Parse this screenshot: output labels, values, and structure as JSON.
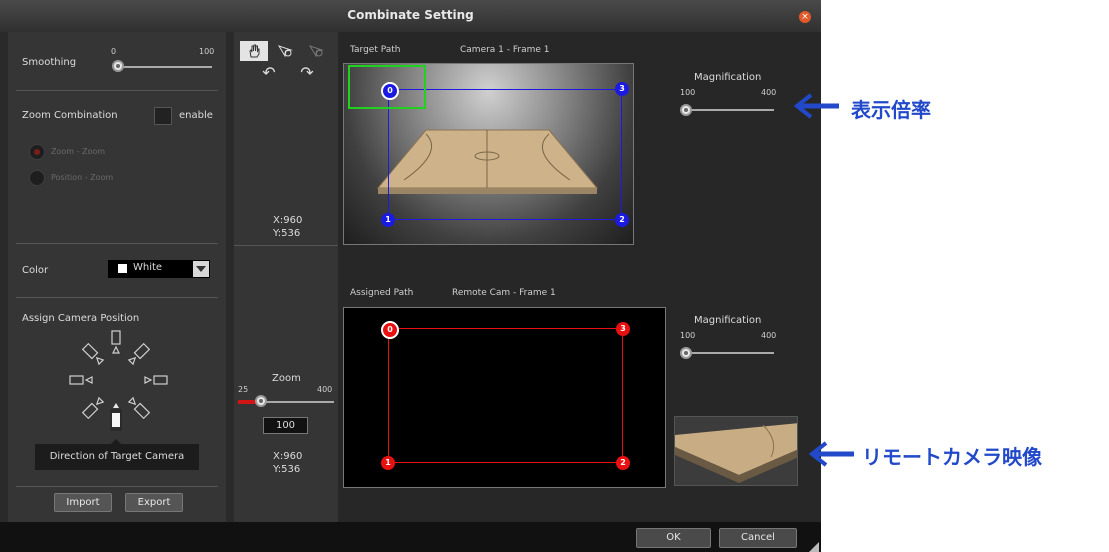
{
  "window": {
    "title": "Combinate Setting",
    "close_glyph": "×"
  },
  "smoothing": {
    "label": "Smoothing",
    "min": "0",
    "max": "100",
    "value": 0
  },
  "zoom_combination": {
    "label": "Zoom Combination",
    "enable_label": "enable",
    "options": [
      "Zoom - Zoom",
      "Position - Zoom"
    ]
  },
  "color": {
    "label": "Color",
    "value": "White"
  },
  "assign_camera": {
    "label": "Assign Camera Position",
    "tooltip": "Direction of Target Camera"
  },
  "buttons": {
    "import": "Import",
    "export": "Export",
    "ok": "OK",
    "cancel": "Cancel"
  },
  "toolbar": {
    "undo_glyph": "↶",
    "redo_glyph": "↷"
  },
  "target": {
    "path_label": "Target Path",
    "camera_label": "Camera 1 - Frame 1",
    "coords_x": "X:960",
    "coords_y": "Y:536",
    "points": [
      "0",
      "1",
      "2",
      "3"
    ],
    "magnification": {
      "label": "Magnification",
      "min": "100",
      "max": "400",
      "value": 100
    }
  },
  "assigned": {
    "path_label": "Assigned Path",
    "camera_label": "Remote Cam - Frame 1",
    "coords_x": "X:960",
    "coords_y": "Y:536",
    "points": [
      "0",
      "1",
      "2",
      "3"
    ],
    "magnification": {
      "label": "Magnification",
      "min": "100",
      "max": "400",
      "value": 100
    }
  },
  "zoom": {
    "label": "Zoom",
    "min": "25",
    "max": "400",
    "value": "100"
  },
  "annotations": {
    "magnification_jp": "表示倍率",
    "remote_cam_jp": "リモートカメラ映像"
  },
  "colors": {
    "target_path": "#1a1ae0",
    "assigned_path": "#e81010",
    "highlight": "#22d022",
    "annotation": "#2149c9"
  }
}
